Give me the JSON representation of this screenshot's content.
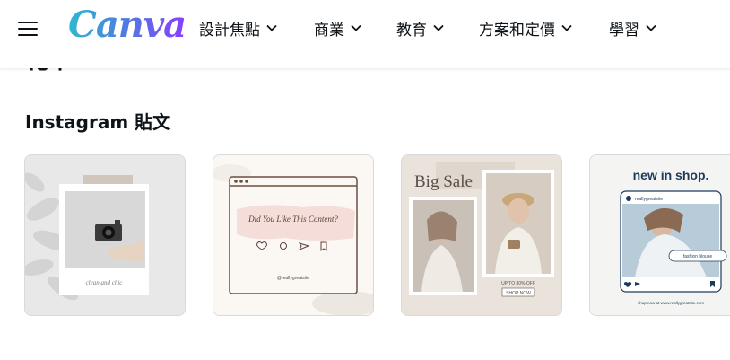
{
  "header": {
    "logo_text": "Canva",
    "nav": [
      {
        "label": "設計焦點"
      },
      {
        "label": "商業"
      },
      {
        "label": "教育"
      },
      {
        "label": "方案和定價"
      },
      {
        "label": "學習"
      }
    ]
  },
  "section_title": "範本",
  "subsection_title": "Instagram 貼文",
  "cards": [
    {
      "caption": "clean and chic"
    },
    {
      "title": "Did You Like This Content?",
      "handle": "@reallygreatsite"
    },
    {
      "title": "Big Sale",
      "offer": "UP TO 80% OFF",
      "cta": "SHOP NOW"
    },
    {
      "title": "new in shop.",
      "account": "reallygreatsite",
      "tag": "fashion blouse",
      "footer": "shop now at www.reallygreatsite.com"
    }
  ],
  "colors": {
    "brand_start": "#2fb8d0",
    "brand_end": "#8b3dff",
    "text": "#0e1318",
    "card_border": "#d9d9d9"
  },
  "icons": [
    "hamburger-menu-icon",
    "chevron-down-icon",
    "heart-icon",
    "comment-icon",
    "send-icon",
    "bookmark-icon",
    "camera-icon"
  ]
}
